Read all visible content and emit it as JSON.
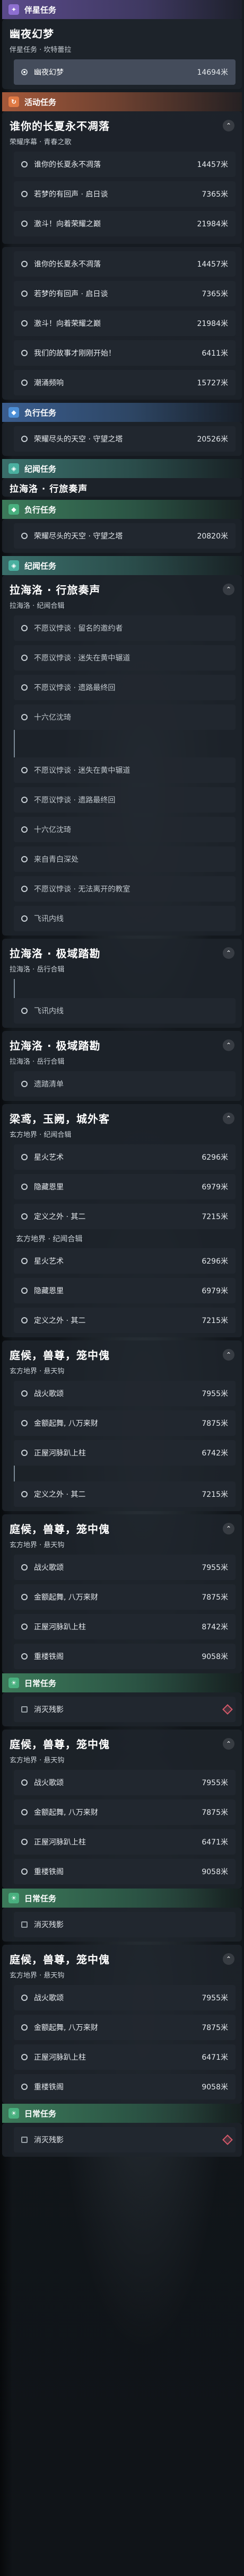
{
  "sections": {
    "companion": {
      "title": "伴星任务",
      "quest_title": "幽夜幻梦",
      "quest_sub": "伴星任务 · 坎特蕾拉",
      "rows": [
        {
          "name": "幽夜幻梦",
          "dist": "14694米"
        }
      ]
    },
    "event1": {
      "title": "活动任务",
      "quest_title": "谁你的长夏永不凋落",
      "quest_sub": "荣耀序幕 · 青春之歌",
      "rows": [
        {
          "name": "谁你的长夏永不凋落",
          "dist": "14457米"
        },
        {
          "name": "若梦的有回声 · 启日谈",
          "dist": "7365米"
        },
        {
          "name": "激斗！向着荣耀之巅",
          "dist": "21984米"
        }
      ]
    },
    "event2": {
      "rows": [
        {
          "name": "谁你的长夏永不凋落",
          "dist": "14457米"
        },
        {
          "name": "若梦的有回声 · 启日谈",
          "dist": "7365米"
        },
        {
          "name": "激斗！向着荣耀之巅",
          "dist": "21984米"
        },
        {
          "name": "我们的故事才刚刚开始！",
          "dist": "6411米"
        },
        {
          "name": "潮涌频响",
          "dist": "15727米"
        }
      ]
    },
    "side1": {
      "title": "负行任务",
      "rows": [
        {
          "name": "荣耀尽头的天空 · 守望之塔",
          "dist": "20526米"
        }
      ]
    },
    "region1": {
      "title": "纪闻任务",
      "quest_title": "拉海洛 · 行旅奏声"
    },
    "side2": {
      "title": "负行任务",
      "rows": [
        {
          "name": "荣耀尽头的天空 · 守望之塔",
          "dist": "20820米"
        }
      ]
    },
    "region2": {
      "title": "纪闻任务",
      "quest_title": "拉海洛 · 行旅奏声",
      "quest_sub": "拉海洛 · 纪闻合辑",
      "rows": [
        {
          "name": "不愿议悖谈 · 留名的邀约者"
        },
        {
          "name": "不愿议悖谈 · 迷失在黄中辗道"
        },
        {
          "name": "不愿议悖谈 · 遗路最终回"
        },
        {
          "name": "十六亿沈琦"
        }
      ],
      "rows2": [
        {
          "name": "不愿议悖谈 · 迷失在黄中辗道"
        },
        {
          "name": "不愿议悖谈 · 遗路最终回"
        },
        {
          "name": "十六亿沈琦"
        },
        {
          "name": "来自青白深处"
        },
        {
          "name": "不愿议悖谈 · 无法离开的教室"
        },
        {
          "name": "飞讯内线"
        }
      ]
    },
    "region3": {
      "quest_title": "拉海洛 · 极域踏勘",
      "quest_sub": "拉海洛 · 岳行合辑",
      "rows": [
        {
          "name": "飞讯内线"
        }
      ]
    },
    "region4": {
      "quest_title": "拉海洛 · 极域踏勘",
      "quest_sub": "拉海洛 · 岳行合辑",
      "rows": [
        {
          "name": "遗踏清单"
        }
      ]
    },
    "liangzhou": {
      "quest_title": "梁鸢，玉阙，城外客",
      "quest_sub": "玄方地界 · 纪闻合辑",
      "rows": [
        {
          "name": "星火艺术",
          "dist": "6296米"
        },
        {
          "name": "隐藏恩里",
          "dist": "6979米"
        },
        {
          "name": "定义之外 · 其二",
          "dist": "7215米"
        }
      ],
      "label2": "玄方地界 · 纪闻合辑",
      "rows2": [
        {
          "name": "星火艺术",
          "dist": "6296米"
        },
        {
          "name": "隐藏恩里",
          "dist": "6979米"
        },
        {
          "name": "定义之外 · 其二",
          "dist": "7215米"
        }
      ]
    },
    "tingyou1": {
      "quest_title": "庭候，兽尊，笼中傀",
      "quest_sub": "玄方地界 · 悬天钩",
      "rows": [
        {
          "name": "战火歌颂",
          "dist": "7955米"
        },
        {
          "name": "金额起舞, 八万来财",
          "dist": "7875米"
        },
        {
          "name": "正屋河脉趴上柱",
          "dist": "6742米"
        }
      ],
      "after": {
        "name": "定义之外 · 其二",
        "dist": "7215米"
      }
    },
    "tingyou2": {
      "quest_title": "庭候，兽尊，笼中傀",
      "quest_sub": "玄方地界 · 悬天钩",
      "rows": [
        {
          "name": "战火歌颂",
          "dist": "7955米"
        },
        {
          "name": "金额起舞, 八万来财",
          "dist": "7875米"
        },
        {
          "name": "正屋河脉趴上柱",
          "dist": "8742米"
        },
        {
          "name": "重楼铁阁",
          "dist": "9058米"
        }
      ]
    },
    "daily1": {
      "title": "日常任务",
      "rows": [
        {
          "name": "消灭残影"
        }
      ]
    },
    "tingyou3": {
      "quest_title": "庭候，兽尊，笼中傀",
      "quest_sub": "玄方地界 · 悬天钩",
      "rows": [
        {
          "name": "战火歌颂",
          "dist": "7955米"
        },
        {
          "name": "金额起舞, 八万来财",
          "dist": "7875米"
        },
        {
          "name": "正屋河脉趴上柱",
          "dist": "6471米"
        },
        {
          "name": "重楼铁阁",
          "dist": "9058米"
        }
      ]
    },
    "daily2": {
      "title": "日常任务",
      "rows": [
        {
          "name": "消灭残影"
        }
      ]
    },
    "tingyou4": {
      "quest_title": "庭候，兽尊，笼中傀",
      "quest_sub": "玄方地界 · 悬天钩",
      "rows": [
        {
          "name": "战火歌颂",
          "dist": "7955米"
        },
        {
          "name": "金额起舞, 八万来财",
          "dist": "7875米"
        },
        {
          "name": "正屋河脉趴上柱",
          "dist": "6471米"
        },
        {
          "name": "重楼铁阁",
          "dist": "9058米"
        }
      ]
    },
    "daily3": {
      "title": "日常任务",
      "rows": [
        {
          "name": "消灭残影"
        }
      ]
    }
  }
}
